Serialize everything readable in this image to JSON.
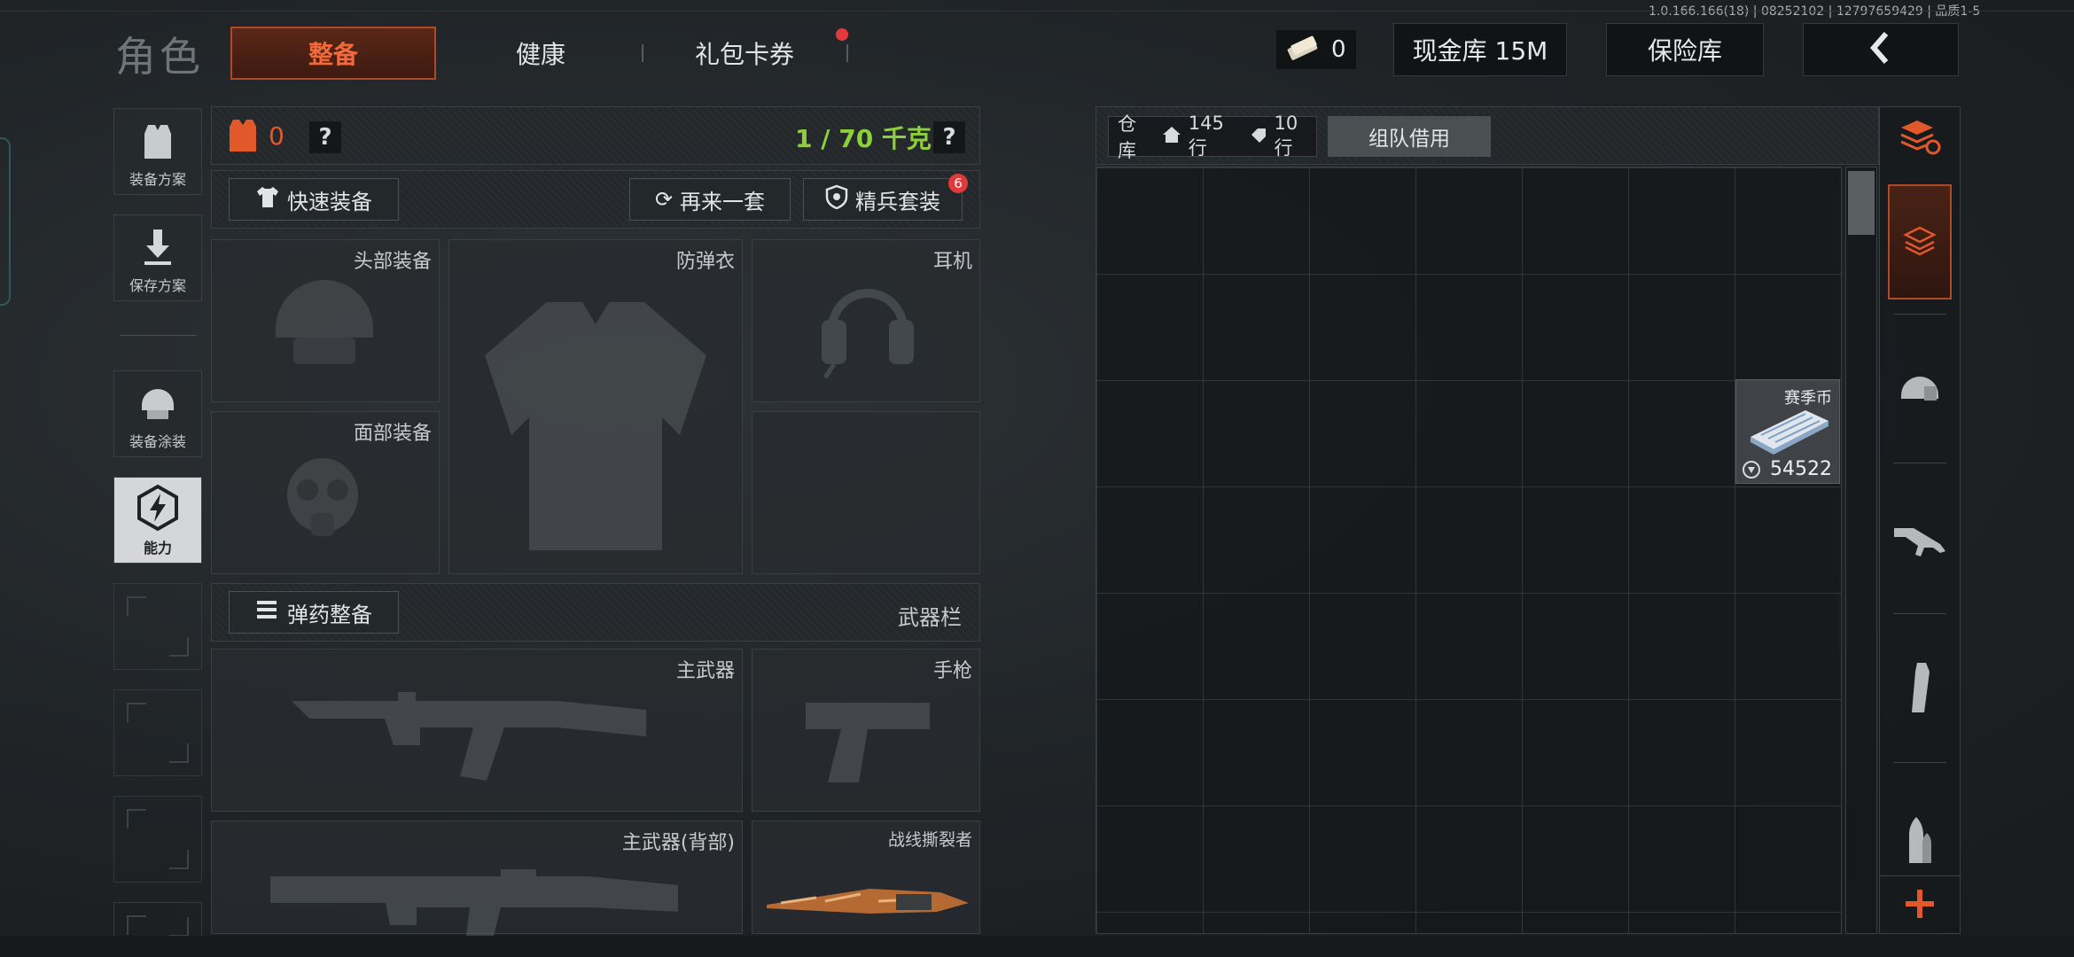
{
  "build_info": "1.0.166.166(18) | 08252102 | 12797659429 | 品质1-5",
  "header": {
    "title": "角色",
    "tabs": [
      {
        "label": "整备",
        "active": true
      },
      {
        "label": "健康",
        "active": false
      },
      {
        "label": "礼包卡券",
        "active": false
      }
    ],
    "voucher_count": "0",
    "cash_vault": "现金库 15M",
    "safe_box": "保险库"
  },
  "sidebar": {
    "loadout_plan": "装备方案",
    "save_plan": "保存方案",
    "gear_skin": "装备涂装",
    "ability": "能力"
  },
  "gear": {
    "armor_value": "0",
    "weight": "1 / 70 千克",
    "help": "?",
    "quick_equip": "快速装备",
    "reroll": "再来一套",
    "elite_set": "精兵套装",
    "elite_badge": "6",
    "slots": {
      "head": "头部装备",
      "vest": "防弹衣",
      "headset": "耳机",
      "face": "面部装备"
    },
    "ammo_equip": "弹药整备",
    "weapon_bar": "武器栏",
    "weapons": {
      "primary": "主武器",
      "pistol": "手枪",
      "primary_back": "主武器(背部)",
      "melee": "战线撕裂者"
    }
  },
  "warehouse": {
    "label": "仓库",
    "rows": "145行",
    "tag_rows": "10行",
    "team_borrow": "组队借用",
    "item": {
      "name": "赛季币",
      "count": "54522"
    }
  },
  "colors": {
    "accent": "#e1592b",
    "green": "#8dd13a",
    "badge": "#e23a3a"
  }
}
